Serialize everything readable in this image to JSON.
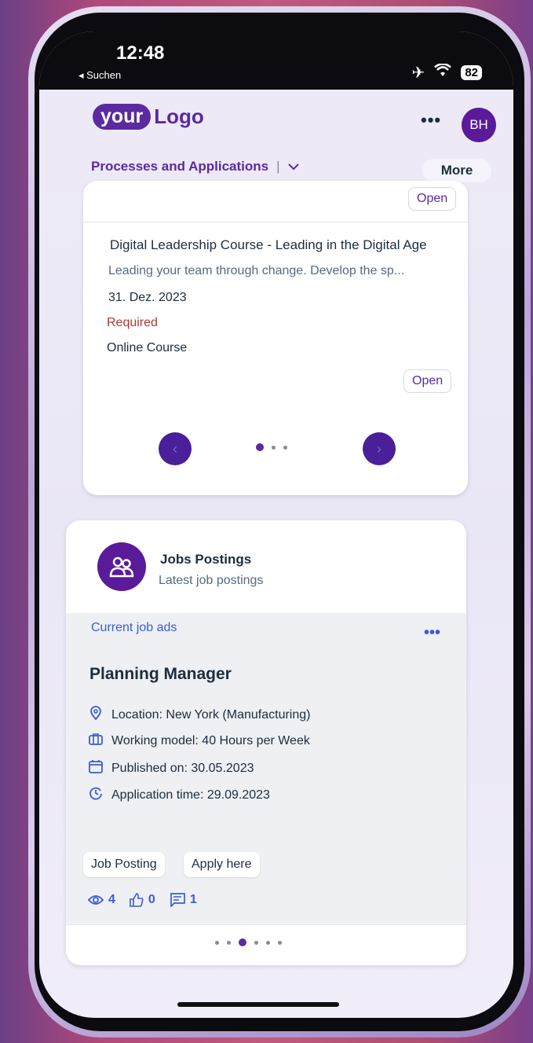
{
  "status_bar": {
    "time": "12:48",
    "back_label": "◂ Suchen",
    "battery": "82"
  },
  "header": {
    "logo_pill": "your",
    "logo_text": "Logo",
    "more_dots": "•••",
    "avatar": "BH",
    "tab_label": "Processes and Applications",
    "more_label": "More"
  },
  "learning_card": {
    "top_open_label": "Open",
    "course": {
      "title": "Digital Leadership Course - Leading in the Digital Age",
      "description": "Leading your team through change. Develop the sp...",
      "date": "31. Dez. 2023",
      "requirement": "Required",
      "type": "Online Course",
      "open_label": "Open"
    },
    "pager": {
      "prev": "‹",
      "next": "›",
      "total": 3,
      "active": 0
    }
  },
  "jobs_card": {
    "title": "Jobs Postings",
    "subtitle": "Latest job postings",
    "section_label": "Current job ads",
    "menu_dots": "•••",
    "job": {
      "title": "Planning Manager",
      "location": "Location: New York (Manufacturing)",
      "working_model": "Working model: 40 Hours per Week",
      "published": "Published on: 30.05.2023",
      "application_time": "Application time: 29.09.2023"
    },
    "buttons": {
      "job_posting": "Job Posting",
      "apply": "Apply here"
    },
    "stats": {
      "views": "4",
      "likes": "0",
      "comments": "1"
    },
    "pager": {
      "total": 6,
      "active": 2
    }
  },
  "colors": {
    "brand": "#5a2aa0",
    "link": "#3b5bd8",
    "required": "#a93a2e"
  }
}
